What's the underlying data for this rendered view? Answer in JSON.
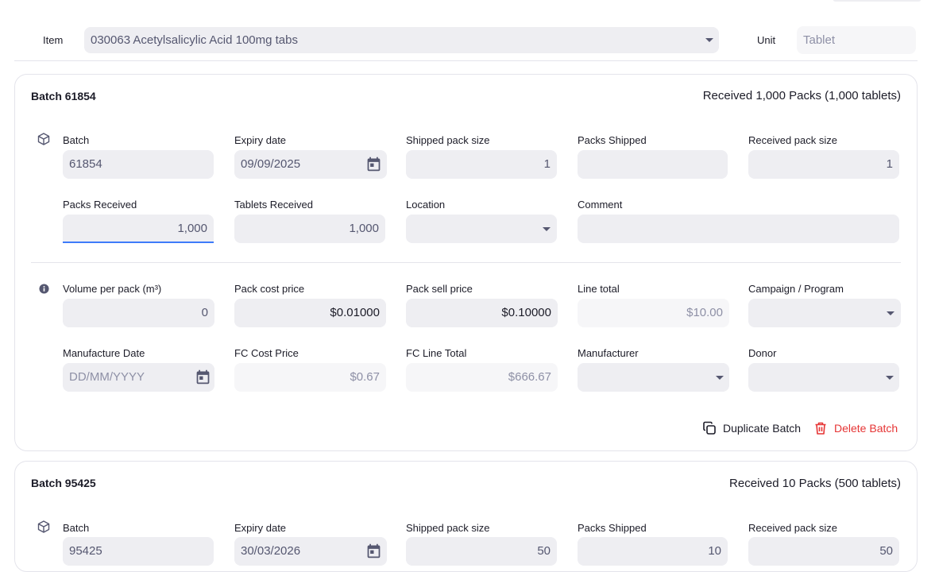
{
  "header": {
    "item_label": "Item",
    "item_value": "030063 Acetylsalicylic Acid 100mg tabs",
    "unit_label": "Unit",
    "unit_placeholder": "Tablet"
  },
  "batch1": {
    "title": "Batch 61854",
    "summary": "Received 1,000 Packs (1,000 tablets)",
    "labels": {
      "batch": "Batch",
      "expiry": "Expiry date",
      "shipped_pack_size": "Shipped pack size",
      "packs_shipped": "Packs Shipped",
      "received_pack_size": "Received pack size",
      "packs_received": "Packs Received",
      "tablets_received": "Tablets Received",
      "location": "Location",
      "comment": "Comment",
      "volume": "Volume per pack (m³)",
      "cost_price": "Pack cost price",
      "sell_price": "Pack sell price",
      "line_total": "Line total",
      "campaign": "Campaign / Program",
      "manufacture_date": "Manufacture Date",
      "fc_cost": "FC Cost Price",
      "fc_line_total": "FC Line Total",
      "manufacturer": "Manufacturer",
      "donor": "Donor"
    },
    "values": {
      "batch": "61854",
      "expiry": "09/09/2025",
      "shipped_pack_size": "1",
      "packs_shipped": "",
      "received_pack_size": "1",
      "packs_received": "1,000",
      "tablets_received": "1,000",
      "location": "",
      "comment": "",
      "volume": "0",
      "cost_price": "$0.01000",
      "sell_price": "$0.10000",
      "line_total": "$10.00",
      "campaign": "",
      "manufacture_date_placeholder": "DD/MM/YYYY",
      "fc_cost": "$0.67",
      "fc_line_total": "$666.67",
      "manufacturer": "",
      "donor": ""
    },
    "actions": {
      "duplicate": "Duplicate Batch",
      "delete": "Delete Batch"
    }
  },
  "batch2": {
    "title": "Batch 95425",
    "summary": "Received 10 Packs (500 tablets)",
    "labels": {
      "batch": "Batch",
      "expiry": "Expiry date",
      "shipped_pack_size": "Shipped pack size",
      "packs_shipped": "Packs Shipped",
      "received_pack_size": "Received pack size"
    },
    "values": {
      "batch": "95425",
      "expiry": "30/03/2026",
      "shipped_pack_size": "50",
      "packs_shipped": "10",
      "received_pack_size": "50"
    }
  },
  "colors": {
    "accent": "#3e7bfa",
    "danger": "#e63535",
    "field_bg": "#eeeef2"
  }
}
